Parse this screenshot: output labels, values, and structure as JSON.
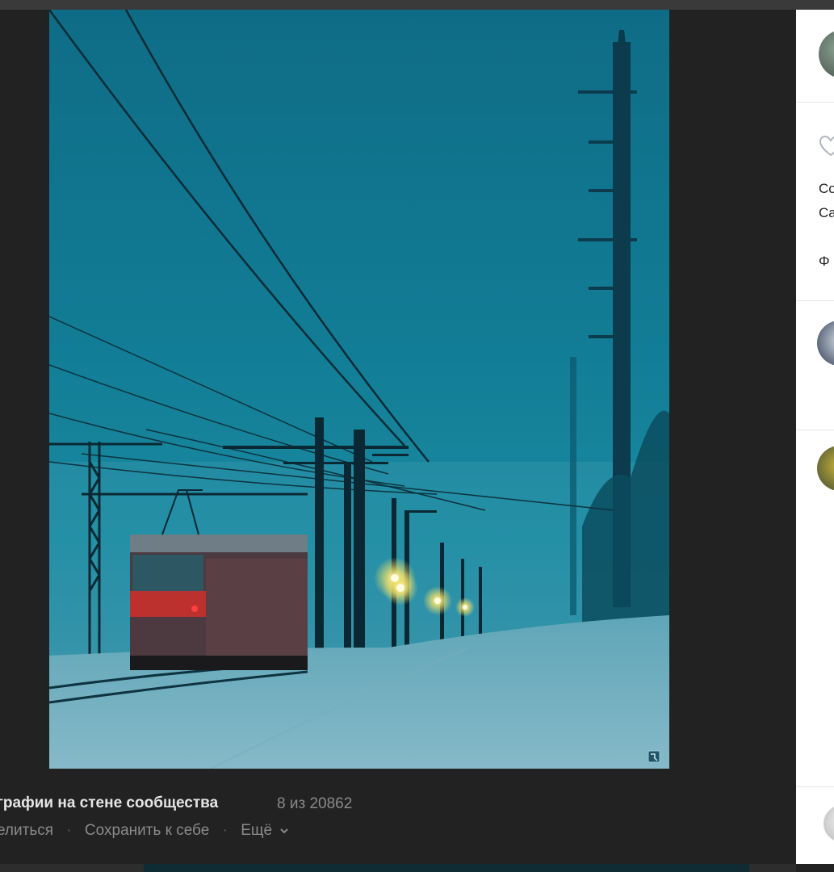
{
  "caption": {
    "album_title": "графии на стене сообщества",
    "counter": "8 из 20862",
    "actions": {
      "share": "елиться",
      "save": "Сохранить к себе",
      "more": "Ещё"
    },
    "separator": "·"
  },
  "side_panel": {
    "text_lines": [
      "Co",
      "Ca",
      "Φ"
    ]
  },
  "icons": {
    "heart": "heart-icon",
    "chevron": "chevron-down-icon",
    "photo_badge": "photo-badge-icon"
  },
  "colors": {
    "viewer_bg": "#222222",
    "sky": "#127d96",
    "lights": "#f5e36a",
    "train_red": "#c9302c"
  }
}
